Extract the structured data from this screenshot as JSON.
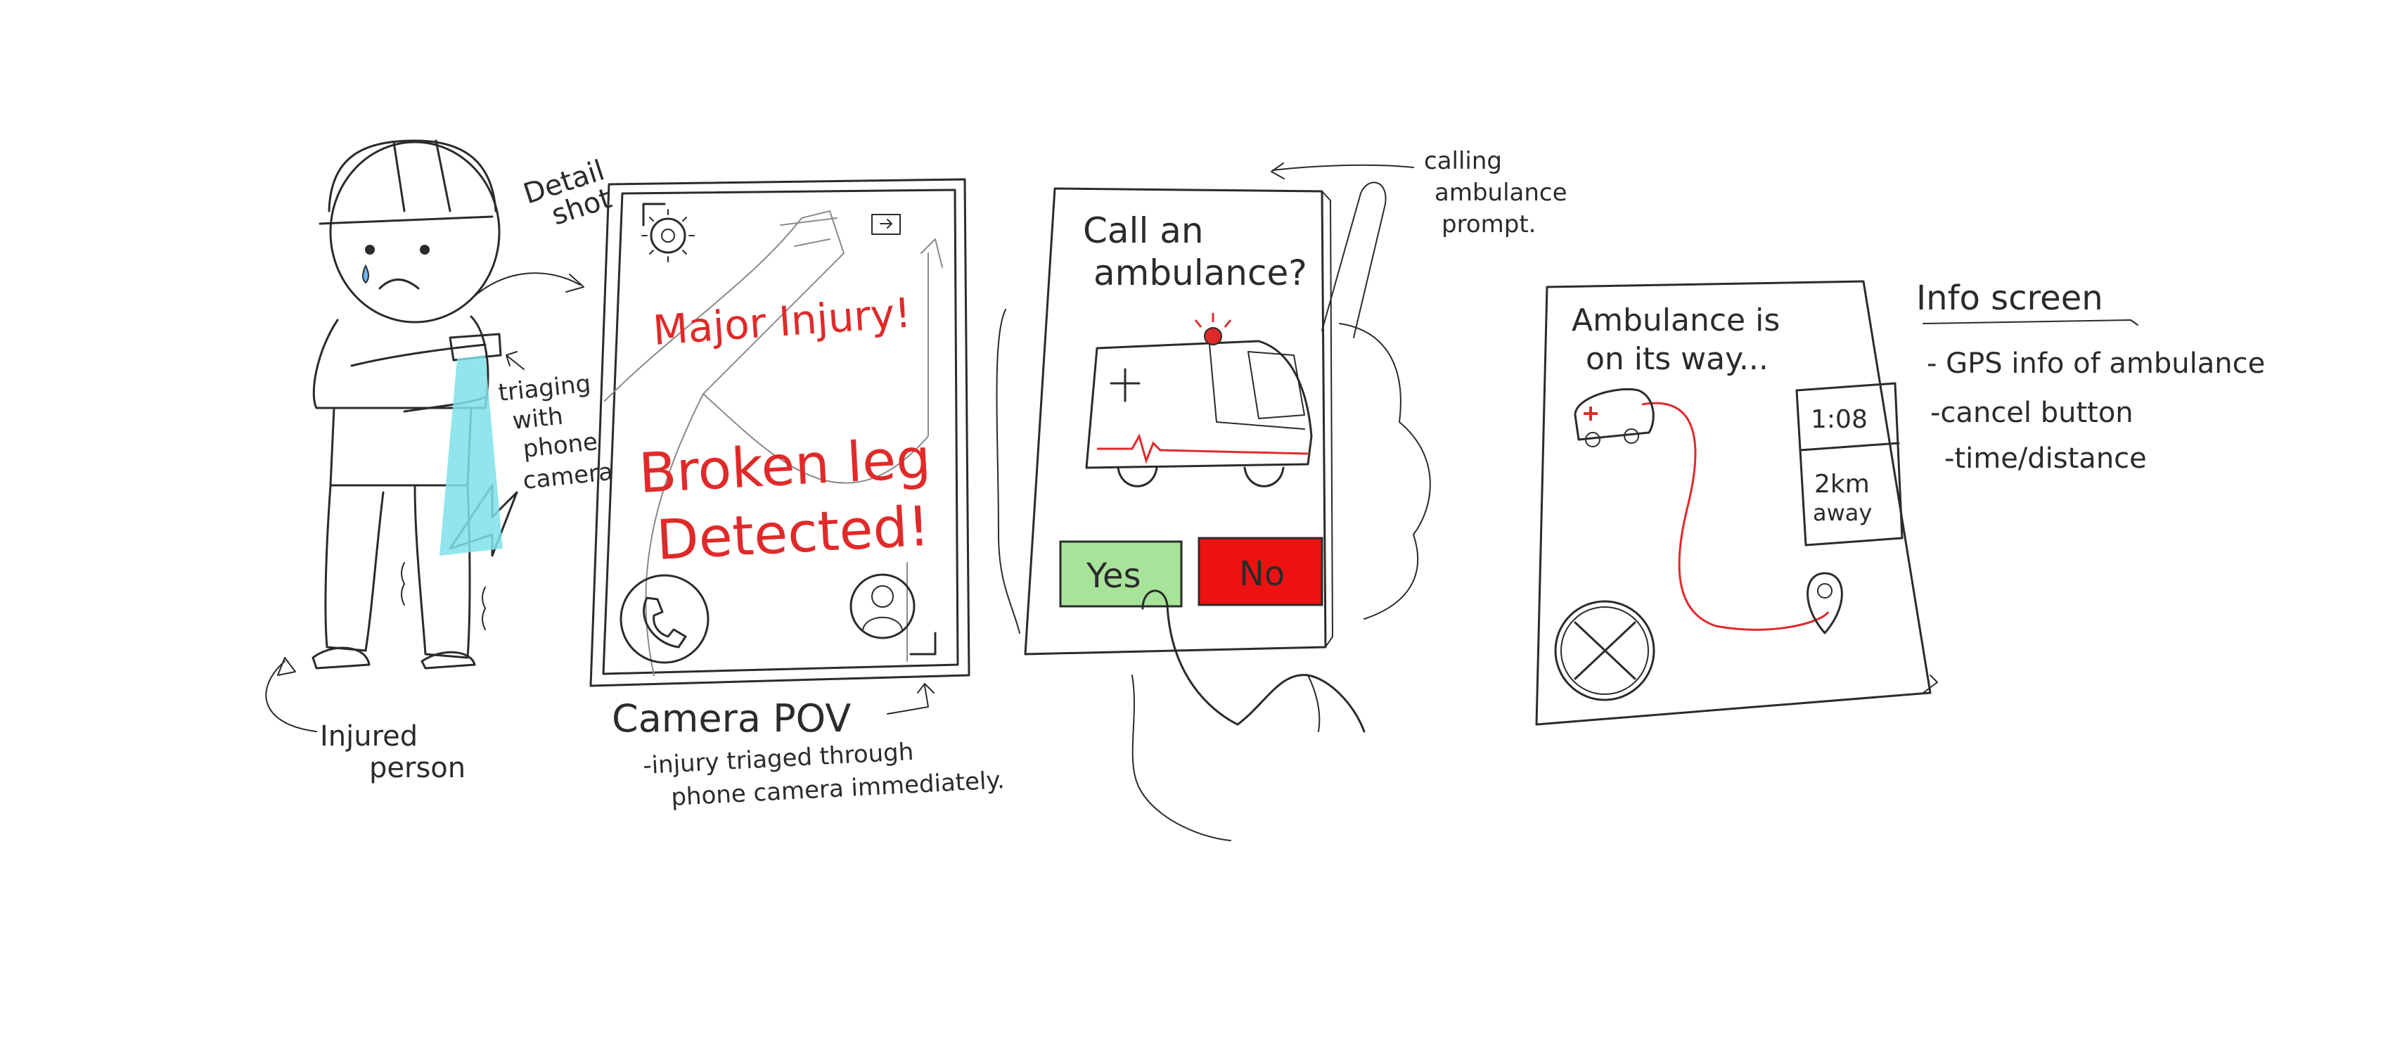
{
  "labels": {
    "detail_shot": [
      "Detail",
      "shot"
    ],
    "triaging": [
      "triaging",
      "with",
      "phone",
      "camera"
    ],
    "injured_person": [
      "Injured",
      "person"
    ],
    "camera_pov_title": "Camera POV",
    "camera_pov_desc": [
      "-injury triaged through",
      "phone camera immediately."
    ],
    "calling_prompt": [
      "calling",
      "ambulance",
      "prompt."
    ]
  },
  "screen1": {
    "alert_1": "Major Injury!",
    "alert_2_line1": "Broken leg",
    "alert_2_line2": "Detected!",
    "icons": [
      "gear-icon",
      "battery-icon",
      "phone-icon",
      "profile-icon"
    ]
  },
  "screen2": {
    "question_line1": "Call an",
    "question_line2": "ambulance?",
    "yes_label": "Yes",
    "no_label": "No",
    "colors": {
      "yes": "#a8e39a",
      "no": "#ee1111"
    }
  },
  "screen3": {
    "status_line1": "Ambulance is",
    "status_line2": "on its way...",
    "time": "1:08",
    "distance_line1": "2km",
    "distance_line2": "away",
    "icons": [
      "ambulance-icon",
      "location-pin-icon",
      "close-icon"
    ]
  },
  "info_notes": {
    "title": "Info screen",
    "items": [
      "- GPS info of ambulance",
      "-cancel button",
      "-time/distance"
    ]
  }
}
